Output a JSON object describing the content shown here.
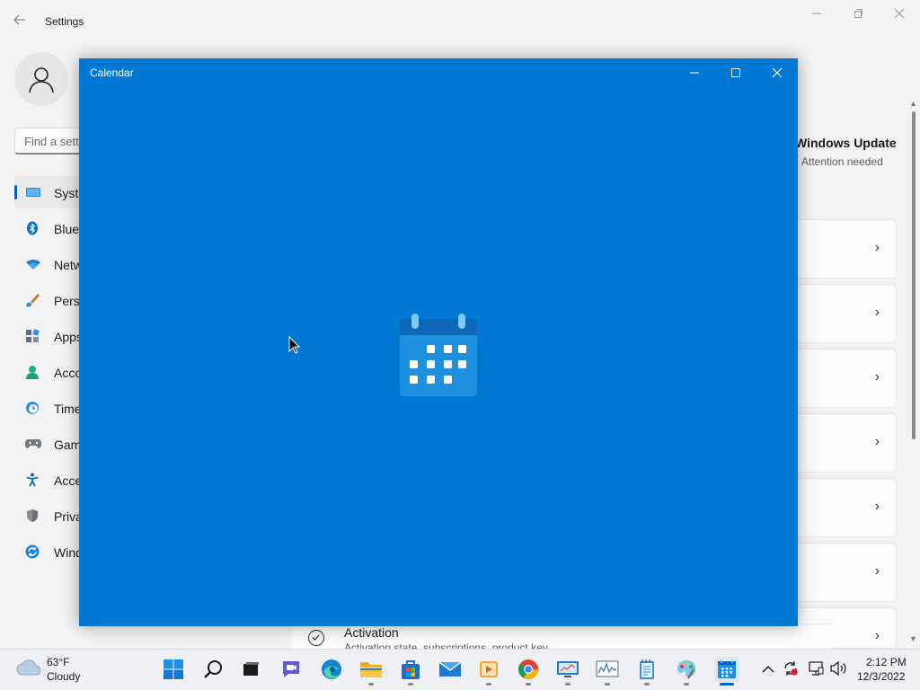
{
  "settings": {
    "title": "Settings",
    "search_placeholder": "Find a sett",
    "nav_items": [
      {
        "label": "Syste",
        "icon": "display-icon",
        "selected": true
      },
      {
        "label": "Blue",
        "icon": "bluetooth-icon"
      },
      {
        "label": "Netw",
        "icon": "wifi-icon"
      },
      {
        "label": "Perso",
        "icon": "brush-icon"
      },
      {
        "label": "Apps",
        "icon": "apps-icon"
      },
      {
        "label": "Acco",
        "icon": "account-icon"
      },
      {
        "label": "Time",
        "icon": "clock-globe-icon"
      },
      {
        "label": "Gam",
        "icon": "gamepad-icon"
      },
      {
        "label": "Acce",
        "icon": "accessibility-icon"
      },
      {
        "label": "Priva",
        "icon": "shield-icon"
      },
      {
        "label": "Wind",
        "icon": "windows-update-icon"
      }
    ],
    "windows_update": {
      "title": "Windows Update",
      "status": "Attention needed"
    },
    "chevron": "›",
    "activation": {
      "title": "Activation",
      "subtitle": "Activation state, subscriptions, product key"
    }
  },
  "calendar": {
    "title": "Calendar"
  },
  "taskbar": {
    "weather": {
      "temp": "63°F",
      "condition": "Cloudy"
    },
    "clock": {
      "time": "2:12 PM",
      "date": "12/3/2022"
    }
  },
  "colors": {
    "calendar_blue": "#0078d4",
    "accent": "#005fb8",
    "taskbar_bg": "#eef0f4"
  }
}
